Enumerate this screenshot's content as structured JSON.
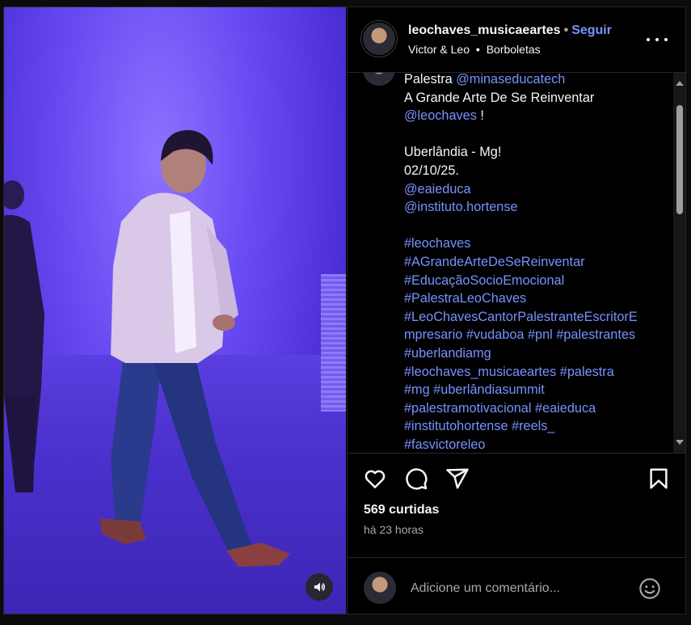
{
  "header": {
    "username": "leochaves_musicaeartes",
    "separator": "•",
    "follow_label": "Seguir",
    "artist": "Victor & Leo",
    "song": "Borboletas",
    "more_icon": "more-horizontal-icon"
  },
  "caption": {
    "lines": [
      [
        {
          "t": "Palestra "
        },
        {
          "t": "@minaseducatech",
          "link": true
        }
      ],
      [
        {
          "t": "A Grande Arte De Se  Reinventar"
        }
      ],
      [
        {
          "t": "@leochaves",
          "link": true
        },
        {
          "t": " !"
        }
      ],
      [
        {
          "t": ""
        }
      ],
      [
        {
          "t": "Uberlândia - Mg!"
        }
      ],
      [
        {
          "t": "02/10/25."
        }
      ],
      [
        {
          "t": "@eaieduca",
          "link": true
        }
      ],
      [
        {
          "t": "@instituto.hortense",
          "link": true
        }
      ],
      [
        {
          "t": ""
        }
      ],
      [
        {
          "t": "#leochaves",
          "link": true
        }
      ],
      [
        {
          "t": "#AGrandeArteDeSeReinventar",
          "link": true
        }
      ],
      [
        {
          "t": "#EducaçãoSocioEmocional",
          "link": true
        }
      ],
      [
        {
          "t": "#PalestraLeoChaves",
          "link": true
        }
      ],
      [
        {
          "t": "#LeoChavesCantorPalestranteEscritorE",
          "link": true
        }
      ],
      [
        {
          "t": "mpresario",
          "link": true
        },
        {
          "t": " "
        },
        {
          "t": "#vudaboa",
          "link": true
        },
        {
          "t": " "
        },
        {
          "t": "#pnl",
          "link": true
        },
        {
          "t": " "
        },
        {
          "t": "#palestrantes",
          "link": true
        }
      ],
      [
        {
          "t": "#uberlandiamg",
          "link": true
        }
      ],
      [
        {
          "t": "#leochaves_musicaeartes",
          "link": true
        },
        {
          "t": " "
        },
        {
          "t": "#palestra",
          "link": true
        }
      ],
      [
        {
          "t": "#mg",
          "link": true
        },
        {
          "t": " "
        },
        {
          "t": "#uberlândiasummit",
          "link": true
        }
      ],
      [
        {
          "t": "#palestramotivacional",
          "link": true
        },
        {
          "t": " "
        },
        {
          "t": "#eaieduca",
          "link": true
        }
      ],
      [
        {
          "t": "#institutohortense",
          "link": true
        },
        {
          "t": " "
        },
        {
          "t": "#reels_",
          "link": true
        }
      ],
      [
        {
          "t": "#fasvictoreleo",
          "link": true
        }
      ]
    ]
  },
  "actions": {
    "icons": [
      "heart-icon",
      "comment-icon",
      "share-icon",
      "bookmark-icon"
    ]
  },
  "stats": {
    "likes": "569 curtidas",
    "posted": "há 23 horas"
  },
  "comment": {
    "placeholder": "Adicione um comentário..."
  },
  "colors": {
    "background": "#000000",
    "link": "#7891ff",
    "secondary_text": "#a8a8a8",
    "border": "#262626"
  }
}
